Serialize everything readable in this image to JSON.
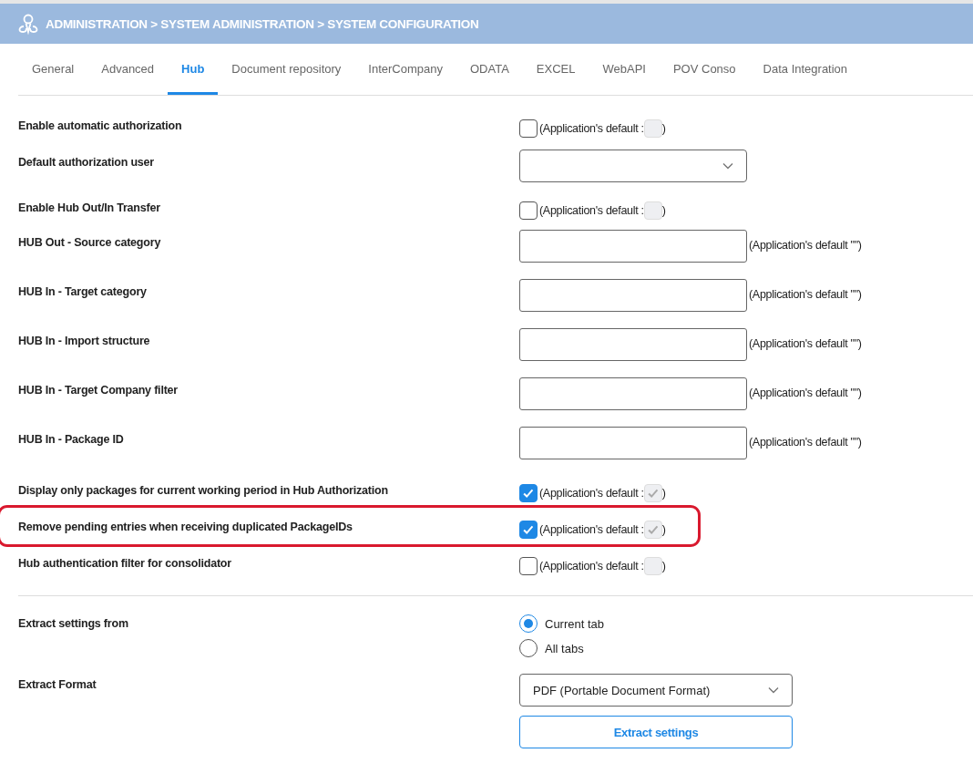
{
  "header": {
    "breadcrumb": "ADMINISTRATION > SYSTEM ADMINISTRATION > SYSTEM CONFIGURATION"
  },
  "tabs": [
    {
      "label": "General",
      "selected": false
    },
    {
      "label": "Advanced",
      "selected": false
    },
    {
      "label": "Hub",
      "selected": true
    },
    {
      "label": "Document repository",
      "selected": false
    },
    {
      "label": "InterCompany",
      "selected": false
    },
    {
      "label": "ODATA",
      "selected": false
    },
    {
      "label": "EXCEL",
      "selected": false
    },
    {
      "label": "WebAPI",
      "selected": false
    },
    {
      "label": "POV Conso",
      "selected": false
    },
    {
      "label": "Data Integration",
      "selected": false
    }
  ],
  "settings": [
    {
      "kind": "checkbox",
      "label": "Enable automatic authorization",
      "checked": false,
      "default_open": "(Application's default :",
      "default_checked": false,
      "default_close": ")",
      "highlighted": false
    },
    {
      "kind": "select",
      "label": "Default authorization user",
      "highlighted": false
    },
    {
      "kind": "checkbox",
      "label": "Enable Hub Out/In Transfer",
      "checked": false,
      "default_open": "(Application's default :",
      "default_checked": false,
      "default_close": ")",
      "highlighted": false
    },
    {
      "kind": "text",
      "label": "HUB Out - Source category",
      "default_text": "(Application's default \"\")",
      "highlighted": false
    },
    {
      "kind": "text",
      "label": "HUB In - Target category",
      "default_text": "(Application's default \"\")",
      "highlighted": false
    },
    {
      "kind": "text",
      "label": "HUB In - Import structure",
      "default_text": "(Application's default \"\")",
      "highlighted": false
    },
    {
      "kind": "text",
      "label": "HUB In - Target Company filter",
      "default_text": "(Application's default \"\")",
      "highlighted": false
    },
    {
      "kind": "text",
      "label": "HUB In - Package ID",
      "default_text": "(Application's default \"\")",
      "highlighted": false
    },
    {
      "kind": "checkbox",
      "label": "Display only packages for current working period in Hub Authorization",
      "checked": true,
      "default_open": "(Application's default :",
      "default_checked": true,
      "default_close": ")",
      "highlighted": false
    },
    {
      "kind": "checkbox",
      "label": "Remove pending entries when receiving duplicated PackageIDs",
      "checked": true,
      "default_open": "(Application's default :",
      "default_checked": true,
      "default_close": ")",
      "highlighted": true
    },
    {
      "kind": "checkbox",
      "label": "Hub authentication filter for consolidator",
      "checked": false,
      "default_open": "(Application's default :",
      "default_checked": false,
      "default_close": ")",
      "highlighted": false
    }
  ],
  "extract": {
    "from_label": "Extract settings from",
    "options": [
      {
        "label": "Current tab",
        "selected": true
      },
      {
        "label": "All tabs",
        "selected": false
      }
    ],
    "format_label": "Extract Format",
    "format_value": "PDF (Portable Document Format)",
    "button": "Extract settings"
  }
}
